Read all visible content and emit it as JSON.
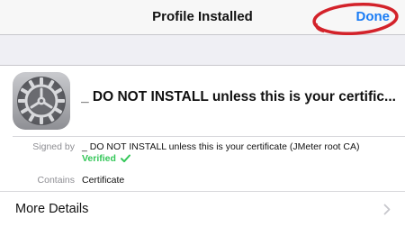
{
  "navbar": {
    "title": "Profile Installed",
    "done_label": "Done"
  },
  "profile": {
    "icon": "settings-gear-icon",
    "name": "_ DO NOT INSTALL unless this is your certificate (JMeter root CA)"
  },
  "details": {
    "signed_by_label": "Signed by",
    "signed_by_value": "_ DO NOT INSTALL unless this is your certificate (JMeter root CA)",
    "verified_label": "Verified",
    "contains_label": "Contains",
    "contains_value": "Certificate"
  },
  "more_details": {
    "label": "More Details",
    "icon": "chevron-right-icon"
  },
  "colors": {
    "accent": "#1a7cf5",
    "verified": "#34c759",
    "annotation": "#d3222a",
    "background": "#efeff4"
  }
}
